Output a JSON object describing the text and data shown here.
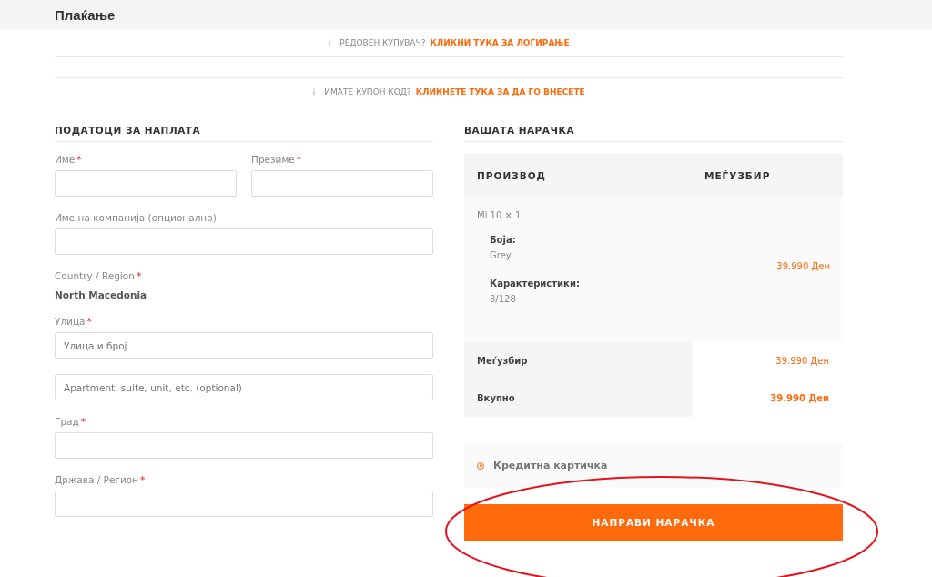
{
  "page_title": "Плаќање",
  "notices": [
    {
      "text": "РЕДОВЕН КУПУВАЧ?",
      "link": "КЛИКНИ ТУКА ЗА ЛОГИРАЊЕ"
    },
    {
      "text": "ИМАТЕ КУПОН КОД?",
      "link": "КЛИКНЕТЕ ТУКА ЗА ДА ГО ВНЕСЕТЕ"
    }
  ],
  "billing": {
    "heading": "ПОДАТОЦИ ЗА НАПЛАТА",
    "rows": [
      {
        "fields": [
          {
            "kind": "input",
            "label": "Име",
            "required_mark": "*"
          },
          {
            "kind": "input",
            "label": "Презиме",
            "required_mark": "*"
          }
        ]
      },
      {
        "fields": [
          {
            "kind": "input",
            "label": "Име на компанија (опционално)"
          }
        ]
      },
      {
        "fields": [
          {
            "kind": "static",
            "label": "Country / Region",
            "required_mark": "*",
            "value": "North Macedonia"
          }
        ]
      },
      {
        "fields": [
          {
            "kind": "input",
            "label": "Улица",
            "required_mark": "*",
            "placeholder": "Улица и број"
          }
        ]
      },
      {
        "fields": [
          {
            "kind": "input",
            "placeholder": "Apartment, suite, unit, etc. (optional)"
          }
        ]
      },
      {
        "fields": [
          {
            "kind": "input",
            "label": "Град",
            "required_mark": "*"
          }
        ]
      },
      {
        "fields": [
          {
            "kind": "input",
            "label": "Држава / Регион",
            "required_mark": "*"
          }
        ]
      }
    ]
  },
  "order": {
    "heading": "ВАШАТА НАРАЧКА",
    "columns": [
      "ПРОИЗВОД",
      "МЕЃУЗБИР"
    ],
    "items": [
      {
        "name": "Mi 10",
        "quantity": "× 1",
        "meta": [
          {
            "label": "Боја:",
            "value": "Grey"
          },
          {
            "label": "Карактеристики:",
            "value": "8/128"
          }
        ],
        "price": "39.990 Ден"
      }
    ],
    "totals": [
      {
        "kind": "subtotal",
        "label": "Меѓузбир",
        "value": "39.990 Ден"
      },
      {
        "kind": "total",
        "label": "Вкупно",
        "value": "39.990 Ден"
      }
    ]
  },
  "payment_methods": [
    {
      "label": "Кредитна картичка",
      "selected": true
    }
  ],
  "place_order_button": "НАПРАВИ НАРАЧКА"
}
